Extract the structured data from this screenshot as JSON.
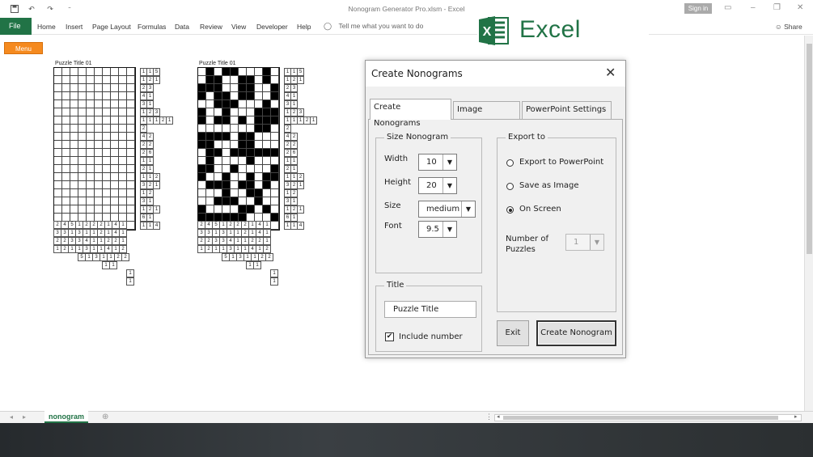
{
  "app": {
    "window_title": "Nonogram Generator Pro.xlsm  -  Excel",
    "sign_in": "Sign in",
    "brand_word": "Excel",
    "file_tab": "File",
    "ribbon_tabs": [
      "Home",
      "Insert",
      "Page Layout",
      "Formulas",
      "Data",
      "Review",
      "View",
      "Developer",
      "Help"
    ],
    "tell_me": "Tell me what you want to do",
    "share": "Share"
  },
  "sheet": {
    "menu_button": "Menu",
    "puzzle_titles": [
      "Puzzle Title 01",
      "Puzzle Title 01"
    ],
    "tab_name": "nonogram",
    "row_clues": [
      [
        "1",
        "1",
        "5"
      ],
      [
        "1",
        "2",
        "1"
      ],
      [
        "2",
        "3"
      ],
      [
        "4",
        "1"
      ],
      [
        "3",
        "1"
      ],
      [
        "1",
        "2",
        "3"
      ],
      [
        "1",
        "1",
        "1",
        "2",
        "1"
      ],
      [
        "2"
      ],
      [
        "4",
        "2"
      ],
      [
        "2",
        "2"
      ],
      [
        "2",
        "6"
      ],
      [
        "1",
        "1"
      ],
      [
        "2",
        "1"
      ],
      [
        "1",
        "1",
        "2"
      ],
      [
        "3",
        "2",
        "1"
      ],
      [
        "1",
        "2"
      ],
      [
        "3",
        "1"
      ],
      [
        "1",
        "2",
        "1"
      ],
      [
        "6",
        "1"
      ],
      [
        "1",
        "1",
        "4"
      ]
    ],
    "col_clues": [
      [
        "2",
        "4",
        "5",
        "1",
        "2",
        "2",
        "2",
        "1",
        "4",
        "1"
      ],
      [
        "3",
        "3",
        "1",
        "3",
        "1",
        "1",
        "2",
        "1",
        "4",
        "1"
      ],
      [
        "2",
        "2",
        "3",
        "3",
        "4",
        "1",
        "1",
        "2",
        "2",
        "1"
      ],
      [
        "1",
        "2",
        "1",
        "1",
        "3",
        "1",
        "1",
        "4",
        "1",
        "2"
      ],
      [
        "5",
        "1",
        "3",
        "1",
        "1",
        "2",
        "2"
      ],
      [
        "1",
        "1"
      ],
      [
        "1"
      ],
      [
        "1"
      ]
    ],
    "solution": [
      "0101100010",
      "0110011010",
      "1110011001",
      "1011011001",
      "0011100010",
      "1001000111",
      "1011010111",
      "0000000110",
      "1111011000",
      "1100011000",
      "0110111111",
      "0100001000",
      "1100100001",
      "1001001011",
      "0111011010",
      "0001001100",
      "0011100100",
      "1000011010",
      "1111110001",
      "0101011110"
    ]
  },
  "dialog": {
    "title": "Create Nonograms",
    "tabs": [
      "Create Nonograms",
      "Image Settings",
      "PowerPoint Settings"
    ],
    "size_group": {
      "legend": "Size Nonogram",
      "width_label": "Width",
      "width_value": "10",
      "height_label": "Height",
      "height_value": "20",
      "size_label": "Size",
      "size_value": "medium",
      "font_label": "Font",
      "font_value": "9.5"
    },
    "export_group": {
      "legend": "Export to",
      "options": [
        "Export to PowerPoint",
        "Save as Image",
        "On Screen"
      ],
      "selected": "On Screen",
      "puzzles_label": "Number of\nPuzzles",
      "puzzles_value": "1"
    },
    "title_group": {
      "legend": "Title",
      "value": "Puzzle Title",
      "include_number_label": "Include number",
      "include_number": true
    },
    "buttons": {
      "exit": "Exit",
      "create": "Create Nonogram"
    }
  }
}
